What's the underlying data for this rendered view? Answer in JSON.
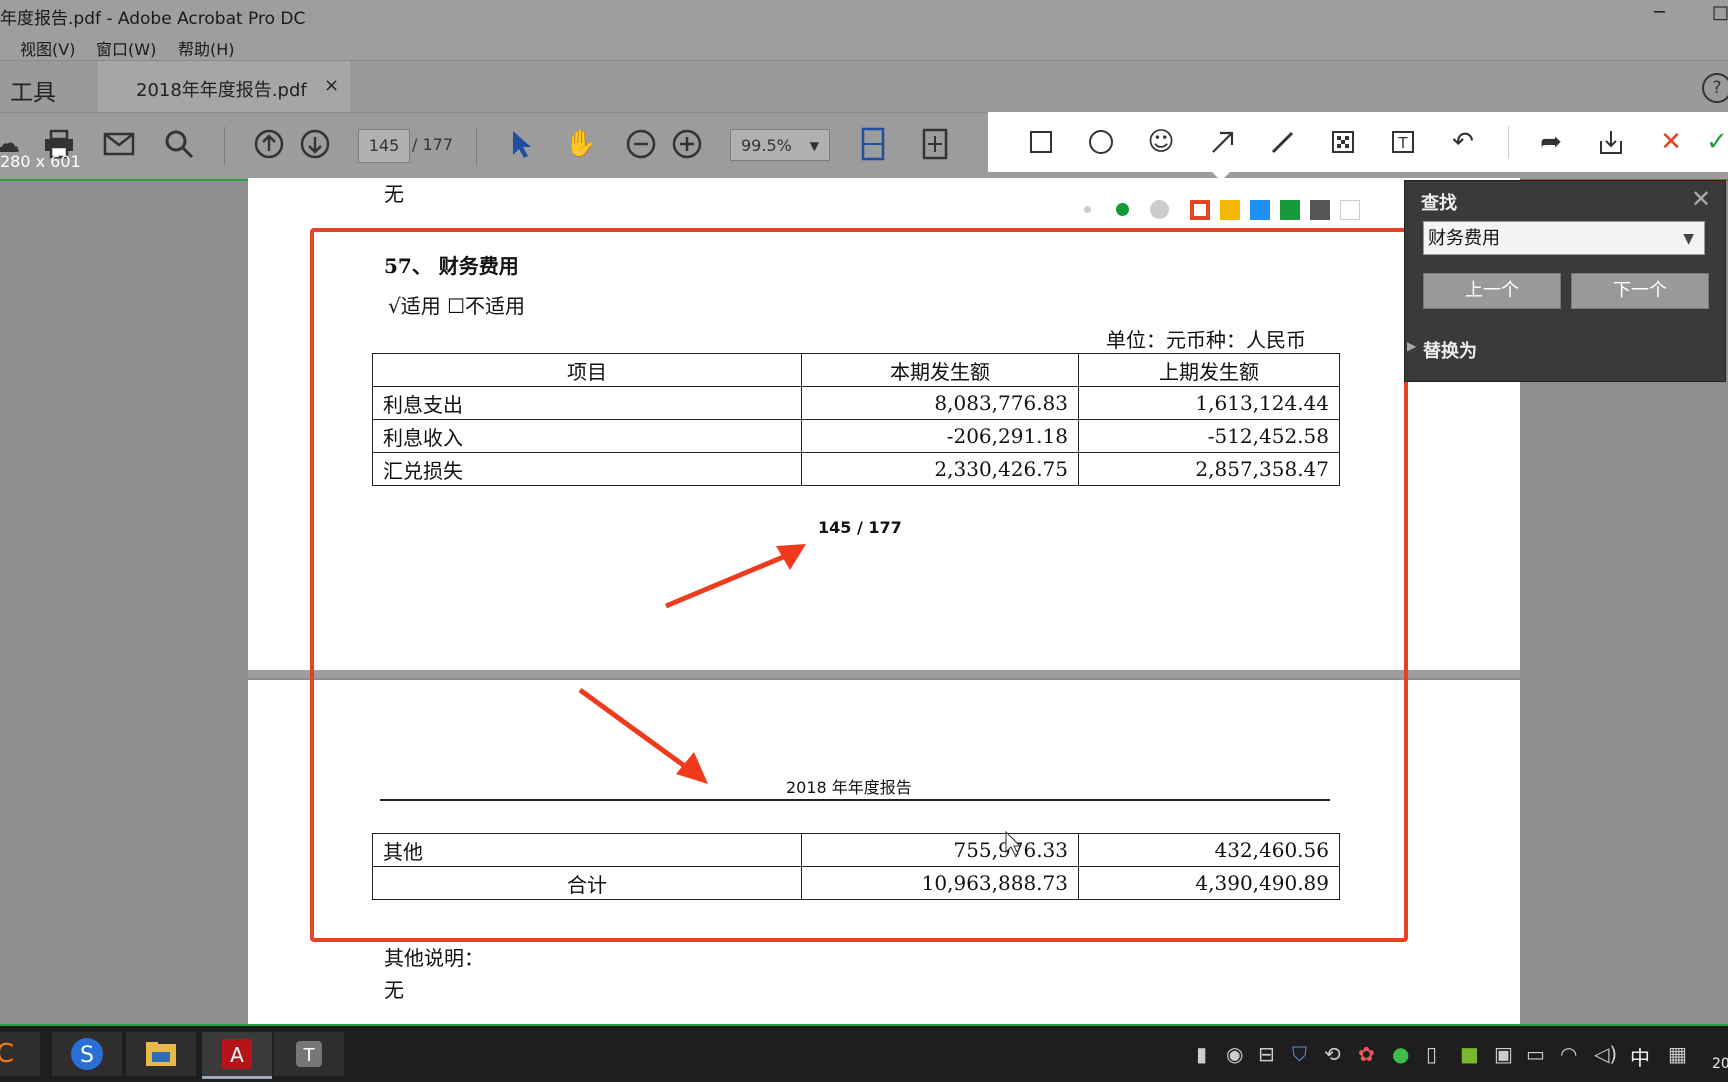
{
  "window": {
    "title": "年度报告.pdf - Adobe Acrobat Pro DC",
    "restore_glyph": "□",
    "minimize_glyph": "─"
  },
  "menu": {
    "items": [
      "视图(V)",
      "窗口(W)",
      "帮助(H)"
    ]
  },
  "tabs": {
    "tools_label": "工具",
    "document_tab": "2018年年度报告.pdf",
    "close_glyph": "×",
    "help_glyph": "?"
  },
  "toolbar": {
    "current_page": "145",
    "total_pages": "/ 177",
    "zoom": "99.5%",
    "selection_dims": "280 x 601",
    "icons": [
      "cloud-icon",
      "print-icon",
      "mail-icon",
      "search-icon",
      "page-up-icon",
      "page-down-icon",
      "select-arrow-icon",
      "hand-icon",
      "zoom-out-icon",
      "zoom-in-icon",
      "fit-width-icon",
      "fit-page-icon"
    ]
  },
  "snip_toolbar": {
    "icons": [
      "rectangle-icon",
      "ellipse-icon",
      "emoji-icon",
      "arrow-icon",
      "pen-icon",
      "mosaic-icon",
      "text-icon",
      "undo-icon",
      "share-icon",
      "download-icon",
      "cancel-icon",
      "confirm-icon"
    ],
    "palette": {
      "sizes": [
        "small",
        "medium",
        "large"
      ],
      "selected_color": "#e84224",
      "colors": [
        "#f5b800",
        "#1e8ff5",
        "#159b3a",
        "#555555",
        "#ffffff"
      ]
    }
  },
  "document": {
    "page1": {
      "top_text": "无",
      "section_title": "57、 财务费用",
      "applicability": "√适用  ☐不适用",
      "unit_line": "单位：元币种：人民币",
      "table": {
        "headers": [
          "项目",
          "本期发生额",
          "上期发生额"
        ],
        "rows": [
          [
            "利息支出",
            "8,083,776.83",
            "1,613,124.44"
          ],
          [
            "利息收入",
            "-206,291.18",
            "-512,452.58"
          ],
          [
            "汇兑损失",
            "2,330,426.75",
            "2,857,358.47"
          ]
        ]
      },
      "page_number": "145 / 177"
    },
    "page2": {
      "header": "2018 年年度报告",
      "table": {
        "rows": [
          [
            "其他",
            "755,976.33",
            "432,460.56"
          ],
          [
            "合计",
            "10,963,888.73",
            "4,390,490.89"
          ]
        ]
      },
      "other_notes_label": "其他说明：",
      "other_notes_value": "无"
    }
  },
  "find_panel": {
    "title": "查找",
    "query": "财务费用",
    "prev_button": "上一个",
    "next_button": "下一个",
    "replace_label": "替换为",
    "close_glyph": "✕"
  },
  "taskbar": {
    "apps": [
      "app-orange-icon",
      "sogou-icon",
      "file-explorer-icon",
      "acrobat-icon",
      "text-editor-icon"
    ],
    "ime": "中",
    "clock_partial": "20"
  }
}
